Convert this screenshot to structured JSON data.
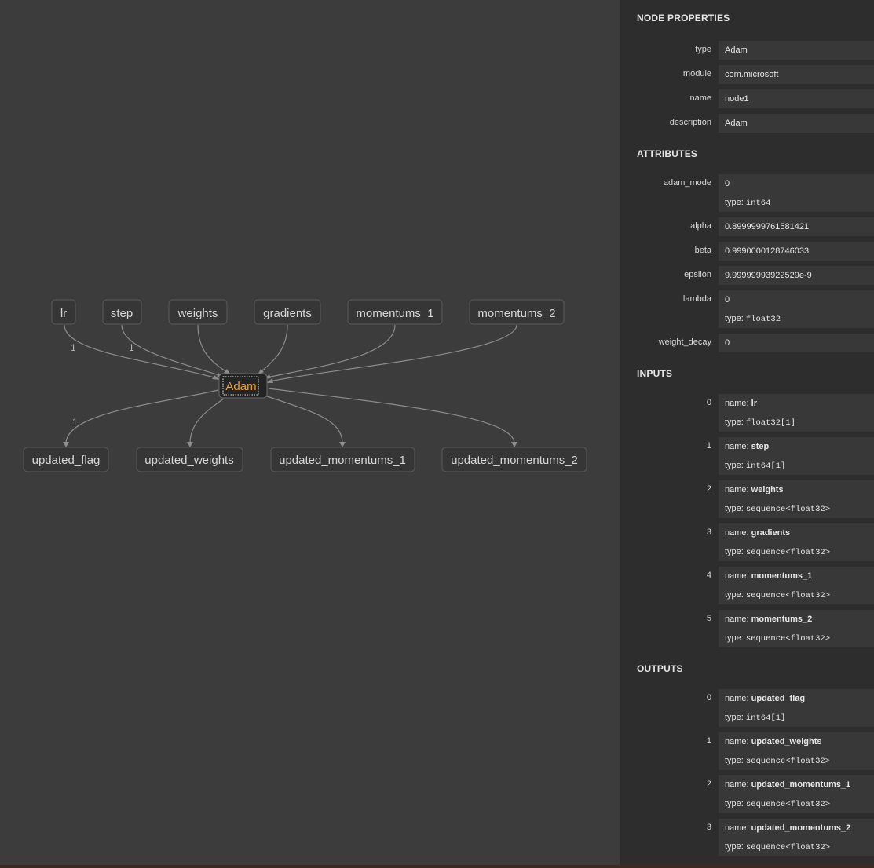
{
  "graph": {
    "operator": "Adam",
    "inputs": [
      "lr",
      "step",
      "weights",
      "gradients",
      "momentums_1",
      "momentums_2"
    ],
    "outputs": [
      "updated_flag",
      "updated_weights",
      "updated_momentums_1",
      "updated_momentums_2"
    ],
    "edge_labels": {
      "lr": "1",
      "step": "1",
      "updated_flag": "1"
    }
  },
  "sidebar": {
    "node_properties_title": "NODE PROPERTIES",
    "properties": [
      {
        "label": "type",
        "value": "Adam"
      },
      {
        "label": "module",
        "value": "com.microsoft"
      },
      {
        "label": "name",
        "value": "node1"
      },
      {
        "label": "description",
        "value": "Adam"
      }
    ],
    "attributes_title": "ATTRIBUTES",
    "attributes": [
      {
        "label": "adam_mode",
        "value": "0",
        "type": "int64"
      },
      {
        "label": "alpha",
        "value": "0.8999999761581421"
      },
      {
        "label": "beta",
        "value": "0.9990000128746033"
      },
      {
        "label": "epsilon",
        "value": "9.99999993922529e-9"
      },
      {
        "label": "lambda",
        "value": "0",
        "type": "float32"
      },
      {
        "label": "weight_decay",
        "value": "0"
      }
    ],
    "inputs_title": "INPUTS",
    "inputs": [
      {
        "index": "0",
        "name": "lr",
        "type": "float32[1]"
      },
      {
        "index": "1",
        "name": "step",
        "type": "int64[1]"
      },
      {
        "index": "2",
        "name": "weights",
        "type": "sequence<float32>"
      },
      {
        "index": "3",
        "name": "gradients",
        "type": "sequence<float32>"
      },
      {
        "index": "4",
        "name": "momentums_1",
        "type": "sequence<float32>"
      },
      {
        "index": "5",
        "name": "momentums_2",
        "type": "sequence<float32>"
      }
    ],
    "outputs_title": "OUTPUTS",
    "outputs": [
      {
        "index": "0",
        "name": "updated_flag",
        "type": "int64[1]"
      },
      {
        "index": "1",
        "name": "updated_weights",
        "type": "sequence<float32>"
      },
      {
        "index": "2",
        "name": "updated_momentums_1",
        "type": "sequence<float32>"
      },
      {
        "index": "3",
        "name": "updated_momentums_2",
        "type": "sequence<float32>"
      }
    ],
    "name_prefix": "name: ",
    "type_prefix": "type: "
  },
  "colors": {
    "accent": "#f0a030",
    "background": "#3c3c3c",
    "sidebar": "#2d2d2d"
  }
}
